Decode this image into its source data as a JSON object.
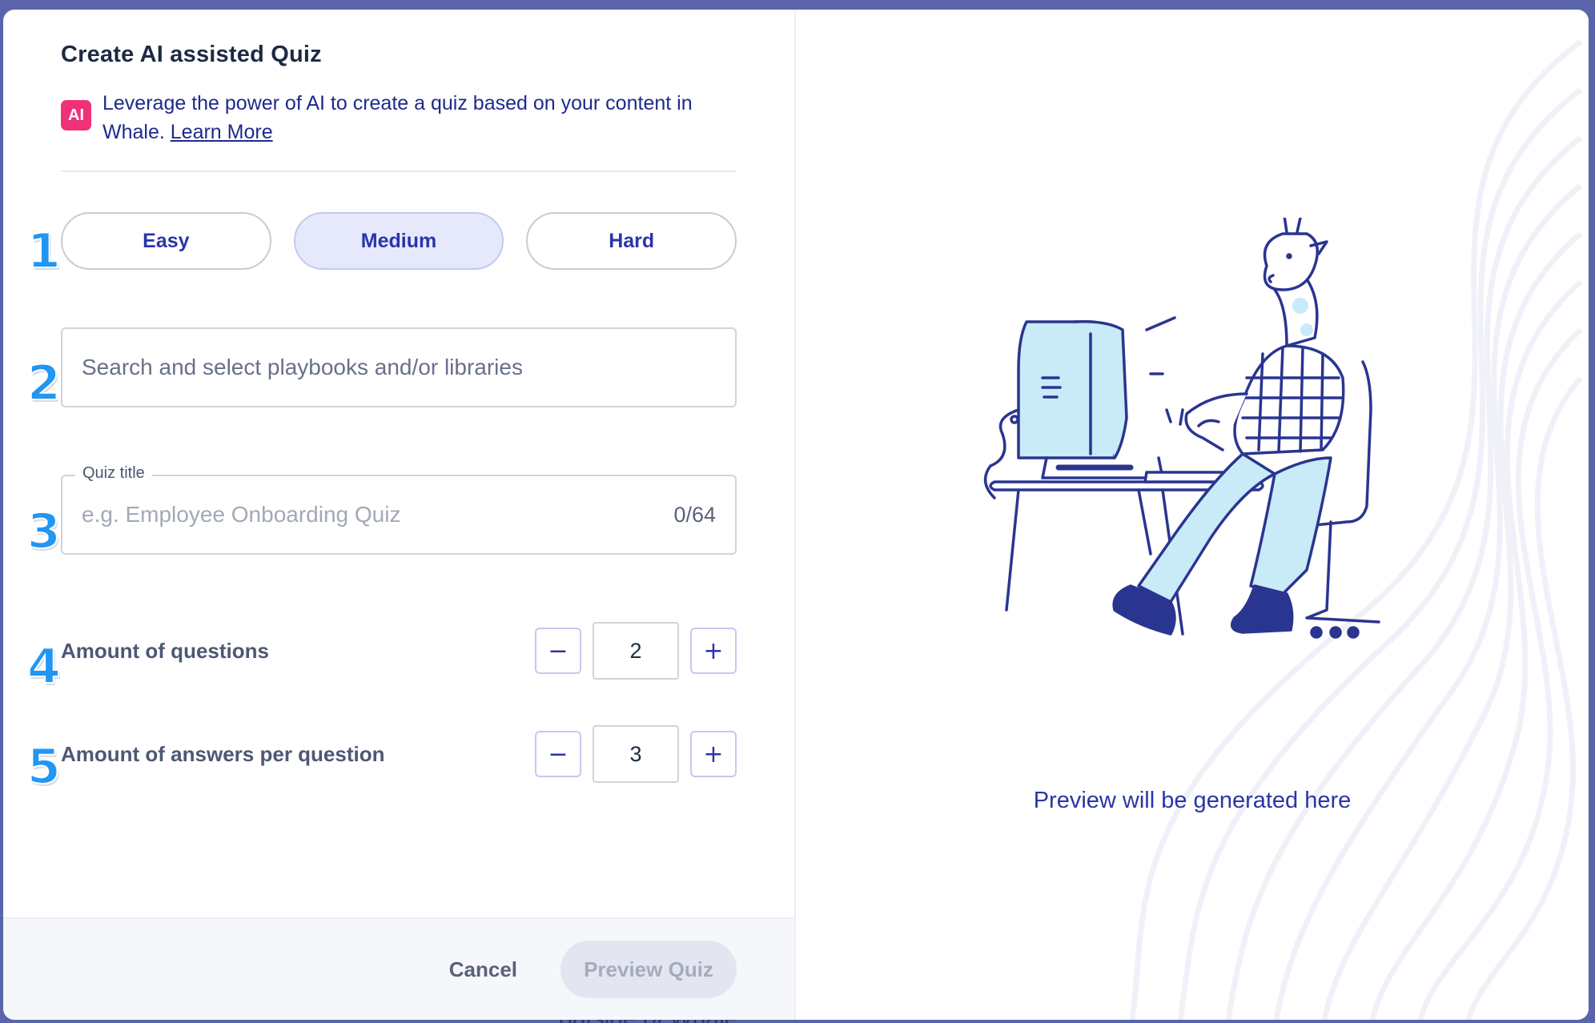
{
  "background": {
    "partial_text": "outside of Whale"
  },
  "modal": {
    "title": "Create AI assisted Quiz",
    "ai_badge": "AI",
    "ai_description": "Leverage the power of AI to create a quiz based on your content in Whale.",
    "learn_more": "Learn More",
    "difficulty": {
      "options": [
        "Easy",
        "Medium",
        "Hard"
      ],
      "selected": "Medium"
    },
    "search": {
      "placeholder": "Search and select playbooks and/or libraries"
    },
    "quiz_title": {
      "label": "Quiz title",
      "placeholder": "e.g. Employee Onboarding Quiz",
      "count": "0/64"
    },
    "questions": {
      "label": "Amount of questions",
      "value": "2"
    },
    "answers": {
      "label": "Amount of answers per question",
      "value": "3"
    },
    "stepper": {
      "minus": "−",
      "plus": "+"
    },
    "footer": {
      "cancel": "Cancel",
      "preview": "Preview Quiz"
    },
    "preview_placeholder": "Preview will be generated here",
    "annotations": [
      "1",
      "2",
      "3",
      "4",
      "5"
    ],
    "colors": {
      "accent": "#2a35a8",
      "ai_badge": "#f0317a",
      "annotation": "#2196f3",
      "selected_bg": "#e6e9fb"
    },
    "icons": {
      "illustration": "giraffe-at-computer-illustration"
    }
  }
}
